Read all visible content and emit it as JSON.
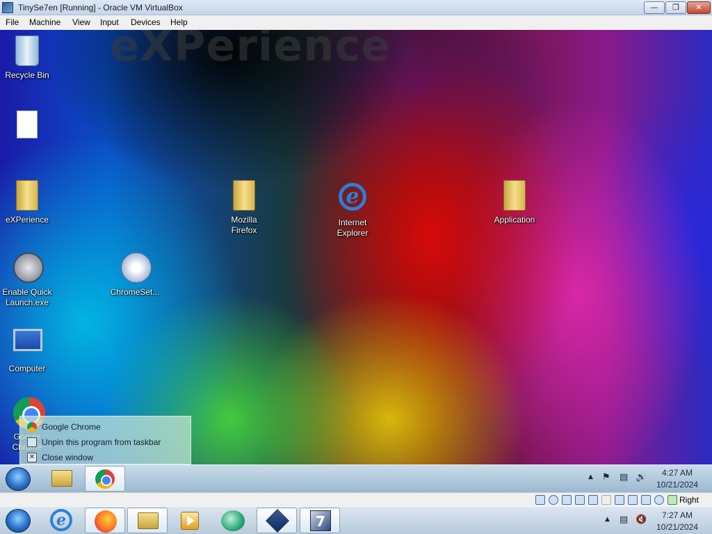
{
  "vbox": {
    "title": "TinySe7en [Running] - Oracle VM VirtualBox",
    "menu": [
      "File",
      "Machine",
      "View",
      "Input",
      "Devices",
      "Help"
    ],
    "host_key": "Right Ctrl"
  },
  "desktop": {
    "wallpaper_text": "eXPerience",
    "icons": [
      {
        "label": "Recycle Bin",
        "icon": "recycle-bin-icon"
      },
      {
        "label": "",
        "icon": "blank-file-icon"
      },
      {
        "label": "eXPerience",
        "icon": "folder-icon"
      },
      {
        "label": "Mozilla Firefox",
        "icon": "folder-icon"
      },
      {
        "label": "Internet Explorer",
        "icon": "internet-explorer-icon"
      },
      {
        "label": "Application",
        "icon": "folder-icon"
      },
      {
        "label": "Enable Quick Launch.exe",
        "icon": "quick-launch-icon"
      },
      {
        "label": "ChromeSet...",
        "icon": "setup-disc-icon"
      },
      {
        "label": "Computer",
        "icon": "computer-icon"
      },
      {
        "label": "Google Chrome",
        "icon": "chrome-icon"
      }
    ]
  },
  "jumplist": {
    "items": [
      {
        "label": "Google Chrome",
        "icon": "chrome-icon"
      },
      {
        "label": "Unpin this program from taskbar",
        "icon": "unpin-icon"
      },
      {
        "label": "Close window",
        "icon": "close-icon"
      }
    ]
  },
  "guest_taskbar": {
    "time": "4:27 AM",
    "date": "10/21/2024"
  },
  "host_taskbar": {
    "time": "7:27 AM",
    "date": "10/21/2024"
  }
}
